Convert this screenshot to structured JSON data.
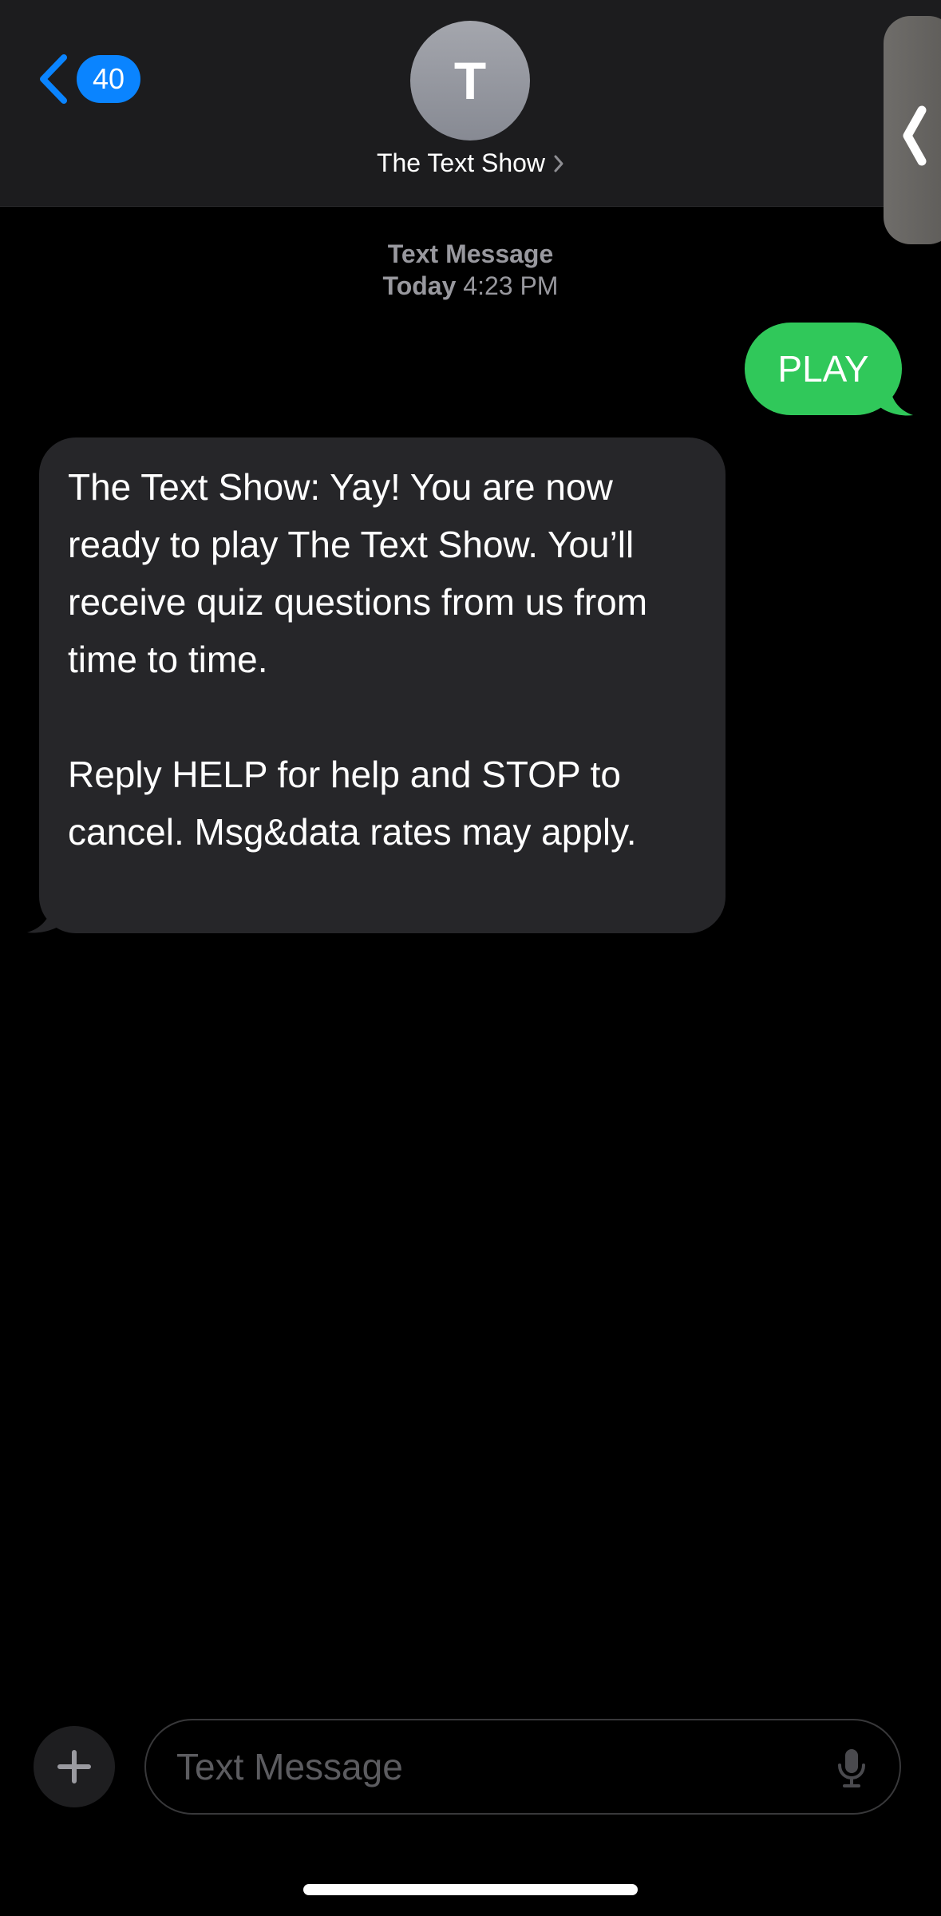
{
  "header": {
    "back_badge_count": "40",
    "avatar_initial": "T",
    "contact_name": "The Text Show"
  },
  "thread": {
    "timestamp_label": "Text Message",
    "timestamp_day": "Today",
    "timestamp_time": "4:23 PM",
    "messages": [
      {
        "direction": "outgoing",
        "text": "PLAY"
      },
      {
        "direction": "incoming",
        "paragraphs": [
          "The Text Show: Yay! You are now ready to play The Text Show. You’ll receive quiz questions from us from time to time.",
          "Reply HELP for help and STOP to cancel. Msg&data rates may apply."
        ]
      }
    ]
  },
  "composer": {
    "placeholder": "Text Message"
  },
  "colors": {
    "accent_blue": "#0a84ff",
    "outgoing_bubble": "#30c85a",
    "incoming_bubble": "#262629",
    "header_background": "#1c1c1e"
  },
  "icons": {
    "back": "chevron-left-icon",
    "contact_details": "chevron-right-icon",
    "side_tab": "chevron-left-icon",
    "attach": "plus-icon",
    "dictation": "microphone-icon"
  }
}
